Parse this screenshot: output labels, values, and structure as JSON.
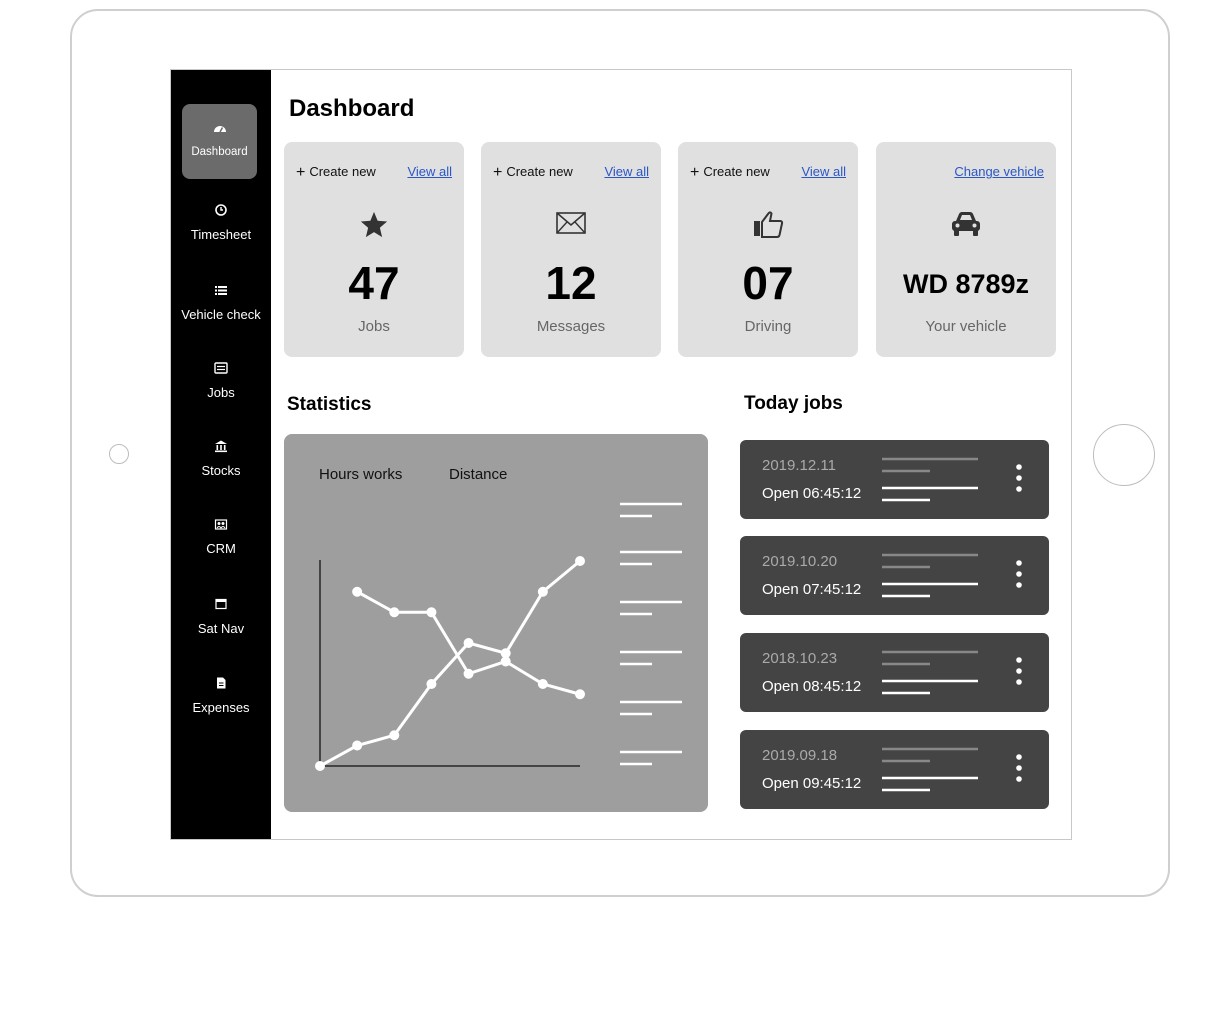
{
  "colors": {
    "sidebar_bg": "#000000",
    "sidebar_active": "#6b6b6b",
    "card_bg": "#e0e0e0",
    "link": "#2a56c6",
    "stats_bg": "#9e9e9e",
    "job_card_bg": "#444444"
  },
  "sidebar": {
    "items": [
      {
        "label": "Dashboard",
        "icon": "dashboard-gauge-icon",
        "active": true
      },
      {
        "label": "Timesheet",
        "icon": "clock-icon"
      },
      {
        "label": "Vehicle check",
        "icon": "list-icon"
      },
      {
        "label": "Jobs",
        "icon": "jobs-list-icon"
      },
      {
        "label": "Stocks",
        "icon": "bank-icon"
      },
      {
        "label": "CRM",
        "icon": "crm-icon"
      },
      {
        "label": "Sat Nav",
        "icon": "calendar-window-icon"
      },
      {
        "label": "Expenses",
        "icon": "document-icon"
      }
    ]
  },
  "header": {
    "title": "Dashboard"
  },
  "cards": [
    {
      "create_label": "Create new",
      "link_label": "View all",
      "icon": "star-icon",
      "value": "47",
      "caption": "Jobs"
    },
    {
      "create_label": "Create new",
      "link_label": "View all",
      "icon": "envelope-icon",
      "value": "12",
      "caption": "Messages"
    },
    {
      "create_label": "Create new",
      "link_label": "View all",
      "icon": "thumbs-up-icon",
      "value": "07",
      "caption": "Driving"
    },
    {
      "link_label": "Change vehicle",
      "icon": "car-icon",
      "value": "WD 8789z",
      "caption": "Your vehicle"
    }
  ],
  "statistics": {
    "title": "Statistics",
    "legend": [
      "Hours works",
      "Distance"
    ]
  },
  "chart_data": {
    "type": "line",
    "title": "",
    "xlabel": "",
    "ylabel": "",
    "x": [
      0,
      1,
      2,
      3,
      4,
      5,
      6,
      7
    ],
    "series": [
      {
        "name": "Hours works",
        "values": [
          null,
          85,
          75,
          75,
          45,
          51,
          40,
          35
        ]
      },
      {
        "name": "Distance",
        "values": [
          0,
          10,
          15,
          40,
          60,
          55,
          85,
          100
        ]
      }
    ],
    "ylim": [
      0,
      100
    ],
    "grid": false
  },
  "today_jobs": {
    "title": "Today jobs",
    "items": [
      {
        "date": "2019.12.11",
        "open": "Open 06:45:12"
      },
      {
        "date": "2019.10.20",
        "open": "Open 07:45:12"
      },
      {
        "date": "2018.10.23",
        "open": "Open 08:45:12"
      },
      {
        "date": "2019.09.18",
        "open": "Open 09:45:12"
      }
    ]
  }
}
